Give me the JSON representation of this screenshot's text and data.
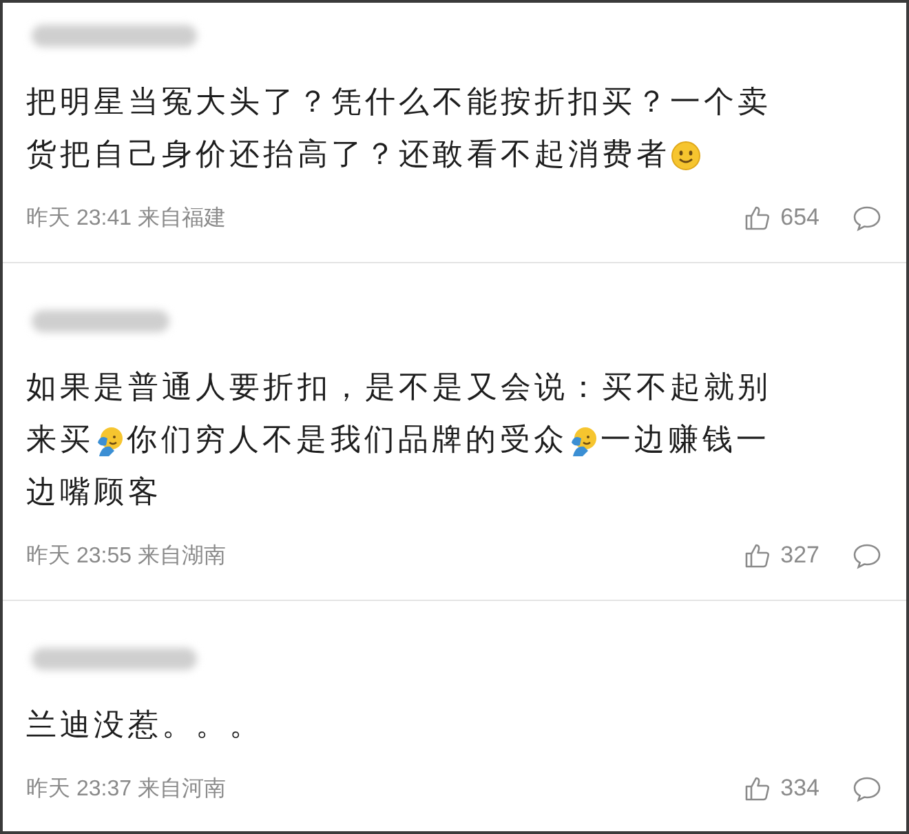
{
  "comments": [
    {
      "lines": [
        [
          {
            "kind": "text",
            "text": "把明星当冤大头了？凭什么不能按折扣买？一个卖"
          }
        ],
        [
          {
            "kind": "text",
            "text": "货把自己身价还抬高了？还敢看不起消费者"
          },
          {
            "kind": "smile"
          }
        ]
      ],
      "meta": "昨天 23:41 来自福建",
      "likes": "654"
    },
    {
      "lines": [
        [
          {
            "kind": "text",
            "text": "如果是普通人要折扣，是不是又会说：买不起就别"
          }
        ],
        [
          {
            "kind": "text",
            "text": "来买"
          },
          {
            "kind": "facepalm"
          },
          {
            "kind": "text",
            "text": "你们穷人不是我们品牌的受众"
          },
          {
            "kind": "facepalm"
          },
          {
            "kind": "text",
            "text": "一边赚钱一"
          }
        ],
        [
          {
            "kind": "text",
            "text": "边嘴顾客"
          }
        ]
      ],
      "meta": "昨天 23:55 来自湖南",
      "likes": "327"
    },
    {
      "lines": [
        [
          {
            "kind": "text",
            "text": "兰迪没惹。。。"
          }
        ]
      ],
      "meta": "昨天 23:37 来自河南",
      "likes": "334"
    }
  ]
}
